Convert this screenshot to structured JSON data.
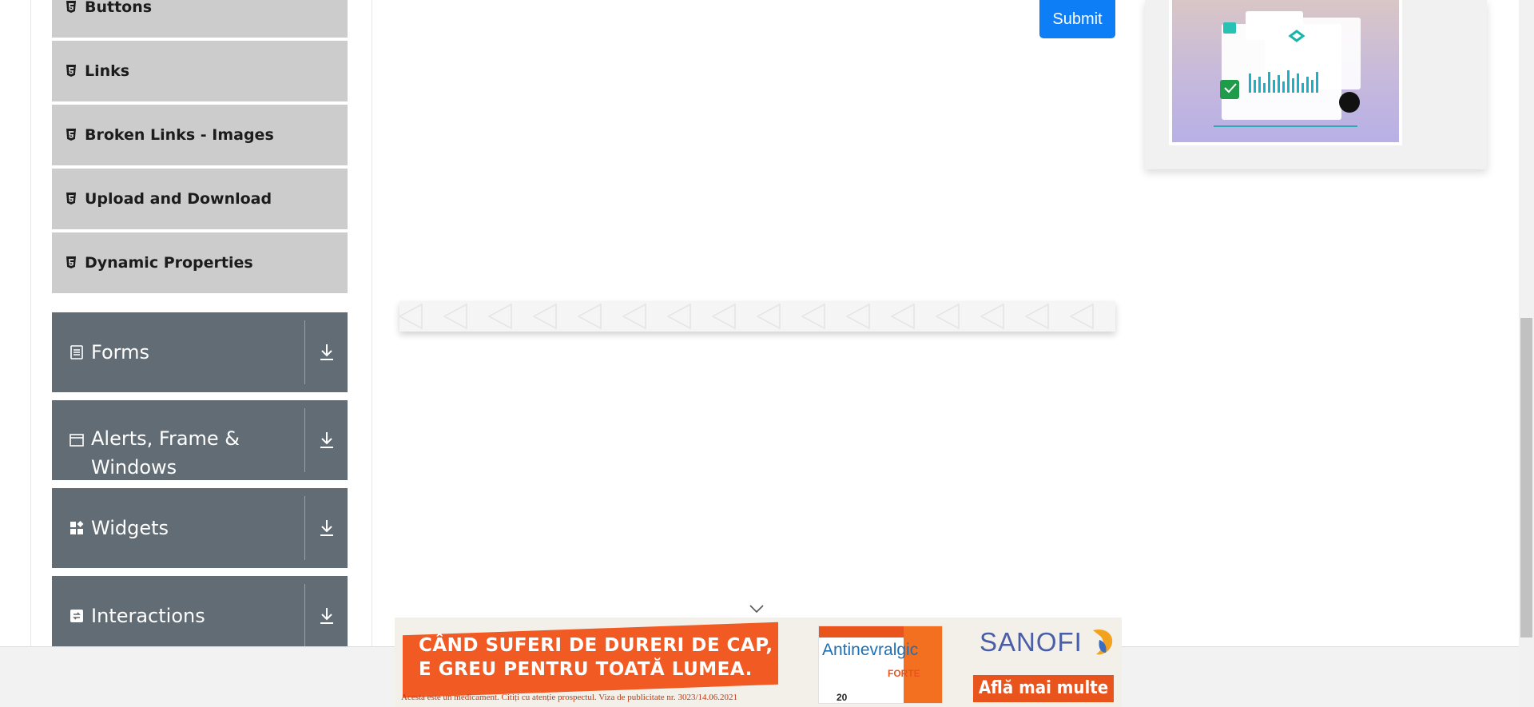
{
  "sidebar": {
    "element_items": [
      {
        "label": "Buttons",
        "icon": "html5-icon"
      },
      {
        "label": "Links",
        "icon": "html5-icon"
      },
      {
        "label": "Broken Links - Images",
        "icon": "html5-icon"
      },
      {
        "label": "Upload and Download",
        "icon": "html5-icon"
      },
      {
        "label": "Dynamic Properties",
        "icon": "html5-icon"
      }
    ],
    "groups": [
      {
        "label": "Forms",
        "icon": "form-icon"
      },
      {
        "label_line1": "Alerts, Frame &",
        "label_line2": "Windows",
        "icon": "window-icon"
      },
      {
        "label": "Widgets",
        "icon": "widgets-icon"
      },
      {
        "label": "Interactions",
        "icon": "interactions-icon"
      }
    ]
  },
  "main": {
    "submit_label": "Submit"
  },
  "colors": {
    "submit": "#0d7ef5",
    "group_bg": "#616c74",
    "item_bg": "#cccccc",
    "banner_orange": "#e9541d"
  },
  "banner": {
    "slogan_line1": "CÂND SUFERI DE DURERI DE CAP,",
    "slogan_line2": "E GREU PENTRU TOATĂ LUMEA.",
    "disclaimer": "Acesta este un medicament. Citiți cu atenție prospectul. Viza de publicitate nr. 3023/14.06.2021",
    "product_name": "Antinevralgic",
    "product_variant": "FORTE",
    "product_count": "20",
    "brand": "SANOFI",
    "cta": "Află mai multe"
  }
}
